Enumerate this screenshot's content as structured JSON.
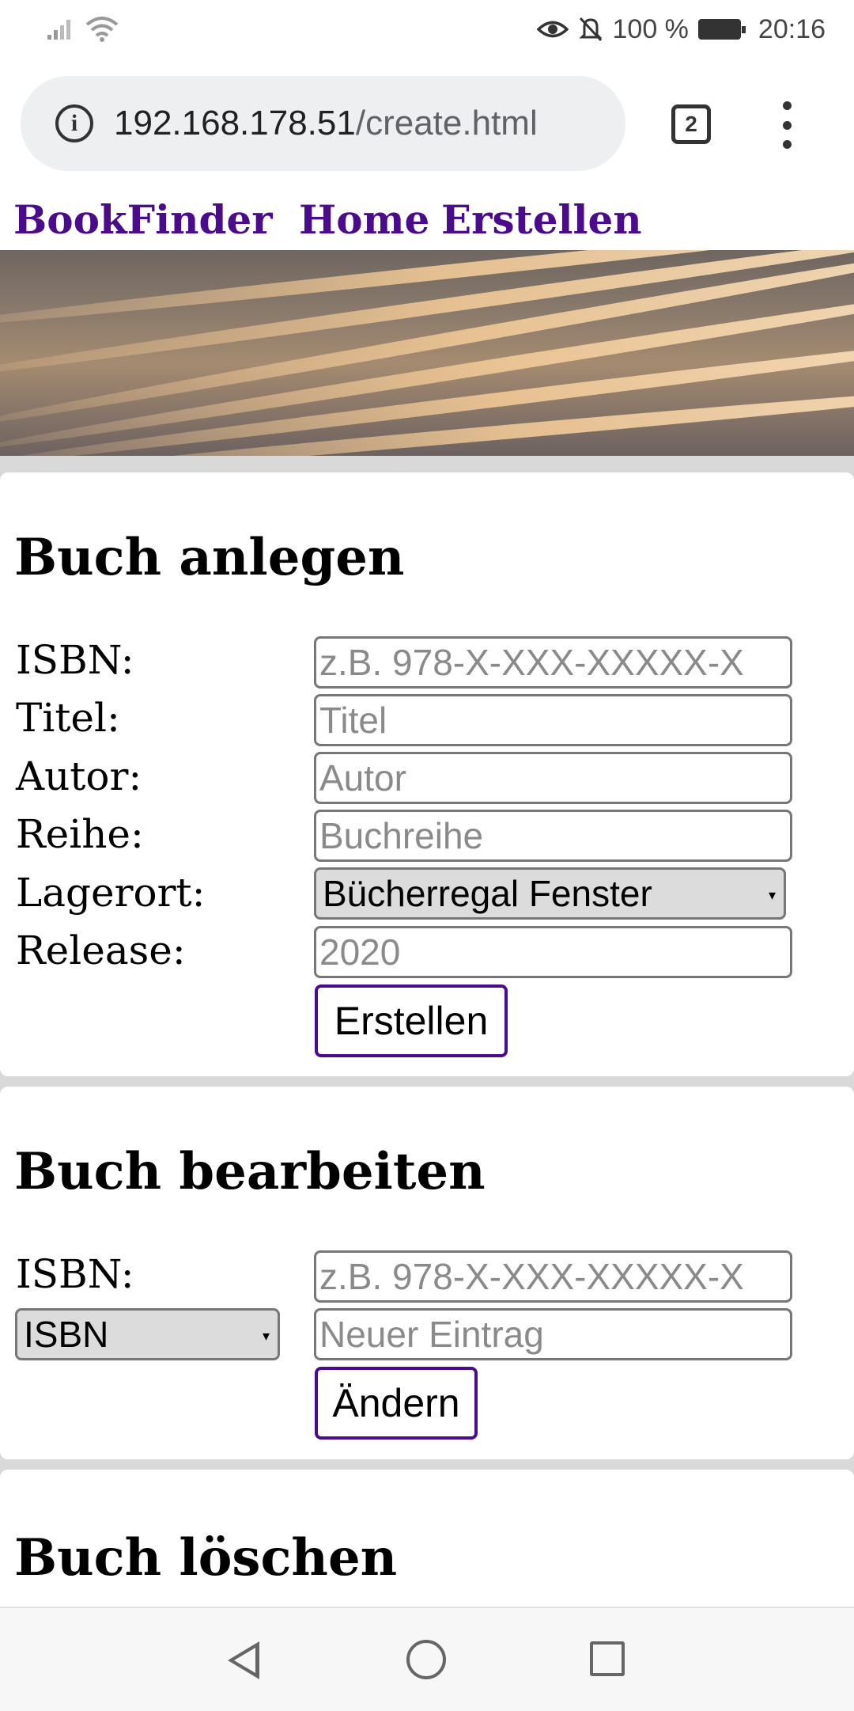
{
  "status_bar": {
    "battery_text": "100 %",
    "time": "20:16",
    "icons": [
      "signal-icon",
      "wifi-icon",
      "eye-icon",
      "bell-off-icon",
      "battery-icon"
    ]
  },
  "browser": {
    "url_host": "192.168.178.51",
    "url_path": "/create.html",
    "tab_count": "2"
  },
  "nav": {
    "brand": "BookFinder",
    "home": "Home",
    "create": "Erstellen",
    "color": "#4b0c8c"
  },
  "create_section": {
    "title": "Buch anlegen",
    "fields": {
      "isbn": {
        "label": "ISBN:",
        "placeholder": "z.B. 978-X-XXX-XXXXX-X"
      },
      "title": {
        "label": "Titel:",
        "placeholder": "Titel"
      },
      "author": {
        "label": "Autor:",
        "placeholder": "Autor"
      },
      "series": {
        "label": "Reihe:",
        "placeholder": "Buchreihe"
      },
      "location": {
        "label": "Lagerort:",
        "selected": "Bücherregal Fenster"
      },
      "release": {
        "label": "Release:",
        "placeholder": "2020"
      }
    },
    "submit_label": "Erstellen"
  },
  "edit_section": {
    "title": "Buch bearbeiten",
    "isbn_label": "ISBN:",
    "isbn_placeholder": "z.B. 978-X-XXX-XXXXX-X",
    "field_select": "ISBN",
    "new_entry_placeholder": "Neuer Eintrag",
    "submit_label": "Ändern"
  },
  "delete_section": {
    "title": "Buch löschen"
  }
}
